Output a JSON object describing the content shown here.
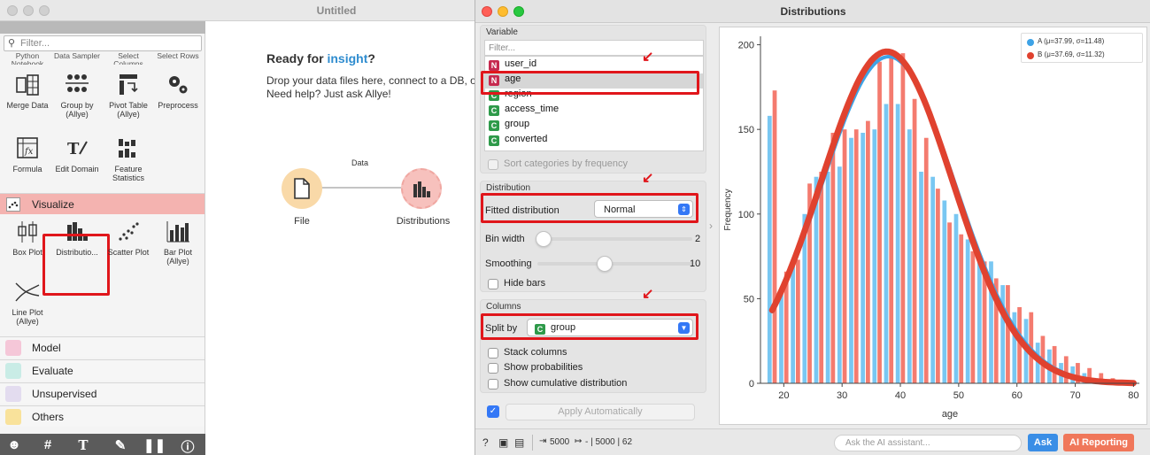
{
  "main_window": {
    "title": "Untitled",
    "toolbox": {
      "filter_placeholder": "Filter...",
      "cut_labels": [
        "Python Notebook",
        "Data Sampler",
        "Select Columns",
        "Select Rows"
      ],
      "transform_widgets": [
        {
          "label": "Merge Data",
          "icon": "merge-data-icon"
        },
        {
          "label": "Group by (Allye)",
          "icon": "group-by-icon"
        },
        {
          "label": "Pivot Table (Allye)",
          "icon": "pivot-table-icon"
        },
        {
          "label": "Preprocess",
          "icon": "preprocess-icon"
        },
        {
          "label": "Formula",
          "icon": "formula-icon"
        },
        {
          "label": "Edit Domain",
          "icon": "edit-domain-icon"
        },
        {
          "label": "Feature Statistics",
          "icon": "feature-statistics-icon"
        }
      ],
      "visualize_category": {
        "label": "Visualize",
        "color": "#f4b3b0"
      },
      "visualize_widgets": [
        {
          "label": "Box Plot",
          "icon": "box-plot-icon"
        },
        {
          "label": "Distributio...",
          "icon": "distributions-icon"
        },
        {
          "label": "Scatter Plot",
          "icon": "scatter-plot-icon"
        },
        {
          "label": "Bar Plot (Allye)",
          "icon": "bar-plot-icon"
        },
        {
          "label": "Line Plot (Allye)",
          "icon": "line-plot-icon"
        }
      ],
      "categories": [
        {
          "label": "Model",
          "color": "#f5c7d8"
        },
        {
          "label": "Evaluate",
          "color": "#c9ece6"
        },
        {
          "label": "Unsupervised",
          "color": "#e3dcef"
        },
        {
          "label": "Others",
          "color": "#f9e29b"
        }
      ],
      "bottom_buttons": [
        "person-icon",
        "hash-icon",
        "text-icon",
        "pen-icon",
        "pause-icon",
        "help-icon"
      ]
    },
    "canvas": {
      "title_prefix": "Ready for ",
      "title_accent": "insight",
      "title_suffix": "?",
      "line1": "Drop your data files here, connect to a DB, or",
      "line2": "Need help? Just ask Allye!",
      "nodes": [
        {
          "label": "File",
          "color": "#f9d9a8"
        },
        {
          "label": "Distributions",
          "color": "#f7c1bd"
        }
      ],
      "link_label": "Data"
    }
  },
  "dist_window": {
    "title": "Distributions",
    "variable_section": "Variable",
    "filter_placeholder": "Filter...",
    "variables": [
      {
        "type": "N",
        "name": "user_id"
      },
      {
        "type": "N",
        "name": "age",
        "selected": true
      },
      {
        "type": "C",
        "name": "region"
      },
      {
        "type": "C",
        "name": "access_time"
      },
      {
        "type": "C",
        "name": "group"
      },
      {
        "type": "C",
        "name": "converted"
      }
    ],
    "sort_categories_label": "Sort categories by frequency",
    "distribution_section": "Distribution",
    "fitted_distribution_label": "Fitted distribution",
    "fitted_distribution_value": "Normal",
    "bin_width_label": "Bin width",
    "bin_width_value": "2",
    "smoothing_label": "Smoothing",
    "smoothing_value": "10",
    "hide_bars_label": "Hide bars",
    "columns_section": "Columns",
    "split_by_label": "Split by",
    "split_by_value": "group",
    "stack_columns_label": "Stack columns",
    "show_probabilities_label": "Show probabilities",
    "show_cumulative_label": "Show cumulative distribution",
    "apply_label": "Apply Automatically",
    "status": {
      "in_count": "5000",
      "out_text": "- | 5000 | 62"
    },
    "ask_placeholder": "Ask the AI assistant...",
    "ask_label": "Ask",
    "ai_reporting_label": "AI Reporting",
    "highlight_color": "#e0161b"
  },
  "chart_data": {
    "type": "bar",
    "xlabel": "age",
    "ylabel": "Frequency",
    "xlim": [
      16,
      81
    ],
    "ylim": [
      0,
      205
    ],
    "xticks": [
      20,
      30,
      40,
      50,
      60,
      70,
      80
    ],
    "yticks": [
      0,
      50,
      100,
      150,
      200
    ],
    "legend_position": "top-right",
    "bin_width": 2,
    "x": [
      18,
      20,
      22,
      24,
      26,
      28,
      30,
      32,
      34,
      36,
      38,
      40,
      42,
      44,
      46,
      48,
      50,
      52,
      54,
      56,
      58,
      60,
      62,
      64,
      66,
      68,
      70,
      72,
      74,
      76,
      78
    ],
    "series": [
      {
        "name": "A (μ=37.99, σ=11.48)",
        "color": "#79c7f2",
        "values": [
          158,
          56,
          70,
          100,
          122,
          125,
          128,
          145,
          148,
          150,
          165,
          165,
          150,
          125,
          122,
          108,
          100,
          85,
          75,
          72,
          58,
          42,
          38,
          24,
          20,
          12,
          10,
          6,
          3,
          2,
          2
        ]
      },
      {
        "name": "B (μ=37.69, σ=11.32)",
        "color": "#f47b6f",
        "values": [
          173,
          66,
          73,
          118,
          125,
          148,
          150,
          150,
          155,
          190,
          192,
          195,
          168,
          145,
          115,
          95,
          88,
          78,
          72,
          62,
          58,
          45,
          42,
          28,
          22,
          16,
          12,
          9,
          6,
          3,
          2
        ]
      }
    ],
    "fitted_curves": [
      {
        "name": "A (μ=37.99, σ=11.48)",
        "mean": 37.99,
        "sd": 11.48,
        "peak": 193,
        "color": "#3ea3e6"
      },
      {
        "name": "B (μ=37.69, σ=11.32)",
        "mean": 37.69,
        "sd": 11.32,
        "peak": 196,
        "color": "#e0422f"
      }
    ]
  }
}
